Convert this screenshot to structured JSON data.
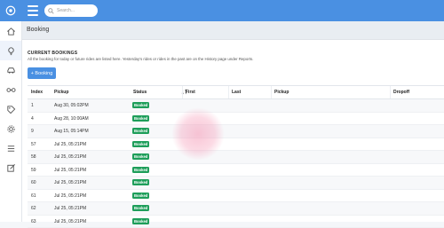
{
  "search": {
    "placeholder": "Search..."
  },
  "header": {
    "title": "Booking"
  },
  "section": {
    "title": "CURRENT BOOKINGS",
    "description": "All the booking for today or future rides are listed here. Yesterday's rides or rides in the past are on the History page under Reports."
  },
  "add_button": {
    "label": "+ Booking"
  },
  "table": {
    "columns": [
      "Index",
      "Pickup",
      "Status",
      "First",
      "Last",
      "Pickup",
      "Dropoff"
    ],
    "rows": [
      {
        "index": "1",
        "pickup": "Aug 30, 05:02PM",
        "status": "Booked",
        "first": "",
        "last": "",
        "pickup_addr": "",
        "dropoff": ""
      },
      {
        "index": "4",
        "pickup": "Aug 28, 10:00AM",
        "status": "Booked",
        "first": "",
        "last": "",
        "pickup_addr": "",
        "dropoff": ""
      },
      {
        "index": "9",
        "pickup": "Aug 15, 05:14PM",
        "status": "Booked",
        "first": "",
        "last": "",
        "pickup_addr": "",
        "dropoff": ""
      },
      {
        "index": "57",
        "pickup": "Jul 25, 05:21PM",
        "status": "Booked",
        "first": "",
        "last": "",
        "pickup_addr": "",
        "dropoff": ""
      },
      {
        "index": "58",
        "pickup": "Jul 25, 05:21PM",
        "status": "Booked",
        "first": "",
        "last": "",
        "pickup_addr": "",
        "dropoff": ""
      },
      {
        "index": "59",
        "pickup": "Jul 25, 05:21PM",
        "status": "Booked",
        "first": "",
        "last": "",
        "pickup_addr": "",
        "dropoff": ""
      },
      {
        "index": "60",
        "pickup": "Jul 25, 05:21PM",
        "status": "Booked",
        "first": "",
        "last": "",
        "pickup_addr": "",
        "dropoff": ""
      },
      {
        "index": "61",
        "pickup": "Jul 25, 05:21PM",
        "status": "Booked",
        "first": "",
        "last": "",
        "pickup_addr": "",
        "dropoff": ""
      },
      {
        "index": "62",
        "pickup": "Jul 25, 05:21PM",
        "status": "Booked",
        "first": "",
        "last": "",
        "pickup_addr": "",
        "dropoff": ""
      },
      {
        "index": "63",
        "pickup": "Jul 25, 05:21PM",
        "status": "Booked",
        "first": "",
        "last": "",
        "pickup_addr": "",
        "dropoff": ""
      }
    ]
  },
  "colors": {
    "topbar": "#4a90e2",
    "badge": "#1e9e5a",
    "accent": "#4a90e2"
  },
  "icons": {
    "sidebar": [
      "home-icon",
      "lightbulb-icon",
      "car-icon",
      "route-icon",
      "tag-icon",
      "gear-icon",
      "list-icon",
      "edit-icon"
    ]
  }
}
